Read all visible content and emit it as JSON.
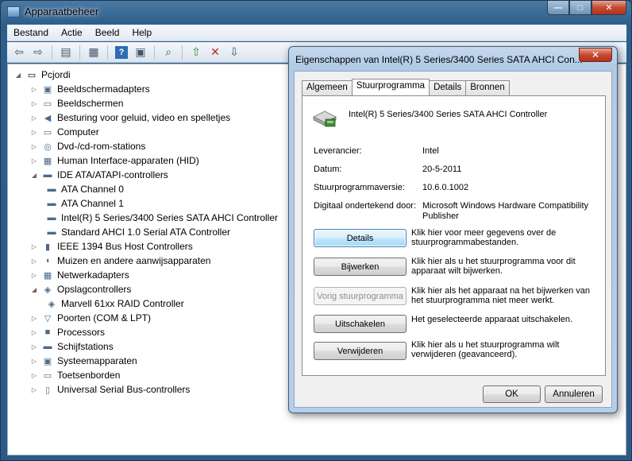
{
  "window": {
    "title": "Apparaatbeheer",
    "min": "—",
    "max": "□",
    "close": "✕"
  },
  "menu": [
    "Bestand",
    "Actie",
    "Beeld",
    "Help"
  ],
  "tree": {
    "root": "Pcjordi",
    "items": [
      {
        "label": "Beeldschermadapters",
        "level": 1,
        "expander": "▷",
        "icon": "display-adapter-icon",
        "glyph": "▣"
      },
      {
        "label": "Beeldschermen",
        "level": 1,
        "expander": "▷",
        "icon": "monitor-icon",
        "glyph": "▭"
      },
      {
        "label": "Besturing voor geluid, video en spelletjes",
        "level": 1,
        "expander": "▷",
        "icon": "speaker-icon",
        "glyph": "◀"
      },
      {
        "label": "Computer",
        "level": 1,
        "expander": "▷",
        "icon": "computer-icon",
        "glyph": "▭"
      },
      {
        "label": "Dvd-/cd-rom-stations",
        "level": 1,
        "expander": "▷",
        "icon": "dvd-drive-icon",
        "glyph": "◎"
      },
      {
        "label": "Human Interface-apparaten (HID)",
        "level": 1,
        "expander": "▷",
        "icon": "hid-icon",
        "glyph": "▦"
      },
      {
        "label": "IDE ATA/ATAPI-controllers",
        "level": 1,
        "expander": "◢",
        "icon": "ide-controller-icon",
        "glyph": "▬"
      },
      {
        "label": "ATA Channel 0",
        "level": 2,
        "expander": "",
        "icon": "ide-channel-icon",
        "glyph": "▬"
      },
      {
        "label": "ATA Channel 1",
        "level": 2,
        "expander": "",
        "icon": "ide-channel-icon",
        "glyph": "▬"
      },
      {
        "label": "Intel(R) 5 Series/3400 Series SATA AHCI Controller",
        "level": 2,
        "expander": "",
        "icon": "sata-controller-icon",
        "glyph": "▬"
      },
      {
        "label": "Standard AHCI 1.0 Serial ATA Controller",
        "level": 2,
        "expander": "",
        "icon": "sata-controller-icon",
        "glyph": "▬"
      },
      {
        "label": "IEEE 1394 Bus Host Controllers",
        "level": 1,
        "expander": "▷",
        "icon": "firewire-icon",
        "glyph": "▮"
      },
      {
        "label": "Muizen en andere aanwijsapparaten",
        "level": 1,
        "expander": "▷",
        "icon": "mouse-icon",
        "glyph": "◖"
      },
      {
        "label": "Netwerkadapters",
        "level": 1,
        "expander": "▷",
        "icon": "network-adapter-icon",
        "glyph": "▦"
      },
      {
        "label": "Opslagcontrollers",
        "level": 1,
        "expander": "◢",
        "icon": "storage-controller-icon",
        "glyph": "◈"
      },
      {
        "label": "Marvell 61xx RAID Controller",
        "level": 2,
        "expander": "",
        "icon": "raid-controller-icon",
        "glyph": "◈"
      },
      {
        "label": "Poorten (COM & LPT)",
        "level": 1,
        "expander": "▷",
        "icon": "port-icon",
        "glyph": "▽"
      },
      {
        "label": "Processors",
        "level": 1,
        "expander": "▷",
        "icon": "processor-icon",
        "glyph": "■"
      },
      {
        "label": "Schijfstations",
        "level": 1,
        "expander": "▷",
        "icon": "disk-drive-icon",
        "glyph": "▬"
      },
      {
        "label": "Systeemapparaten",
        "level": 1,
        "expander": "▷",
        "icon": "system-device-icon",
        "glyph": "▣"
      },
      {
        "label": "Toetsenborden",
        "level": 1,
        "expander": "▷",
        "icon": "keyboard-icon",
        "glyph": "▭"
      },
      {
        "label": "Universal Serial Bus-controllers",
        "level": 1,
        "expander": "▷",
        "icon": "usb-icon",
        "glyph": "▯"
      }
    ]
  },
  "dialog": {
    "title": "Eigenschappen van Intel(R) 5 Series/3400 Series SATA AHCI Con...",
    "close": "✕",
    "tabs": [
      "Algemeen",
      "Stuurprogramma",
      "Details",
      "Bronnen"
    ],
    "active_tab": "Stuurprogramma",
    "device_name": "Intel(R) 5 Series/3400 Series SATA AHCI Controller",
    "props": [
      {
        "label": "Leverancier:",
        "value": "Intel"
      },
      {
        "label": "Datum:",
        "value": "20-5-2011"
      },
      {
        "label": "Stuurprogrammaversie:",
        "value": "10.6.0.1002"
      },
      {
        "label": "Digitaal ondertekend door:",
        "value": "Microsoft Windows Hardware Compatibility Publisher"
      }
    ],
    "buttons": [
      {
        "label": "Details",
        "desc": "Klik hier voor meer gegevens over de stuurprogrammabestanden.",
        "state": "focus"
      },
      {
        "label": "Bijwerken",
        "desc": "Klik hier als u het stuurprogramma voor dit apparaat wilt bijwerken.",
        "state": "normal"
      },
      {
        "label": "Vorig stuurprogramma",
        "desc": "Klik hier als het apparaat na het bijwerken van het stuurprogramma niet meer werkt.",
        "state": "disabled"
      },
      {
        "label": "Uitschakelen",
        "desc": "Het geselecteerde apparaat uitschakelen.",
        "state": "normal"
      },
      {
        "label": "Verwijderen",
        "desc": "Klik hier als u het stuurprogramma wilt verwijderen (geavanceerd).",
        "state": "normal"
      }
    ],
    "ok": "OK",
    "cancel": "Annuleren"
  }
}
